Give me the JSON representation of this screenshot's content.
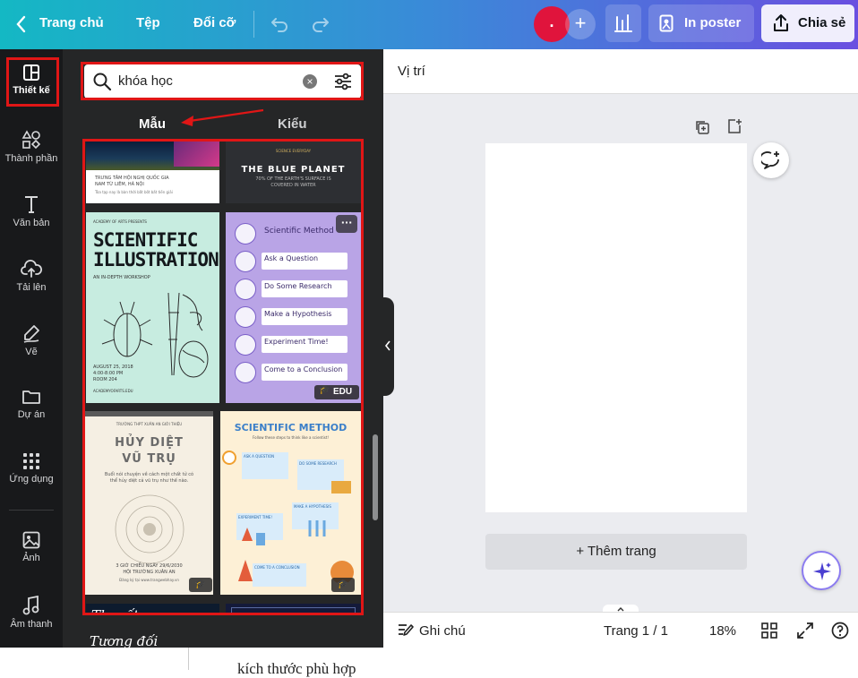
{
  "topbar": {
    "home_label": "Trang chủ",
    "file_label": "Tệp",
    "resize_label": "Đổi cỡ",
    "avatar_text": ".",
    "print_label": "In poster",
    "share_label": "Chia sẻ"
  },
  "rail": {
    "design": "Thiết kế",
    "elements": "Thành phần",
    "text": "Văn bản",
    "upload": "Tải lên",
    "draw": "Vẽ",
    "projects": "Dự án",
    "apps": "Ứng dụng",
    "photos": "Ảnh",
    "audio": "Âm thanh"
  },
  "search": {
    "value": "khóa học"
  },
  "tabs": {
    "templates": "Mẫu",
    "styles": "Kiểu"
  },
  "cards": {
    "c1_line1": "TRƯNG TÂM HỘI NGHỊ QUỐC GIA",
    "c1_line2": "NAM TỪ LIÊM, HÀ NỘI",
    "c1_line3": "Tòa tạp nay là bàn thời bắt bốt bất tiền giải",
    "c2_kicker": "SCIENCE EVERYDAY",
    "c2_title": "THE BLUE PLANET",
    "c2_sub": "70% OF THE EARTH'S SURFACE IS COVERED IN WATER",
    "c3_kicker": "ACADEMY OF ARTS PRESENTS",
    "c3_title": "SCIENTIFIC ILLUSTRATION",
    "c3_sub": "AN IN-DEPTH WORKSHOP",
    "c3_date": "AUGUST 25, 2018",
    "c3_time": "4:00-8:00 PM",
    "c3_room": "ROOM 204",
    "c3_url": "ACADEMYOFARTS.EDU",
    "c4_steps": [
      "Scientific Method",
      "Ask a Question",
      "Do Some Research",
      "Make a Hypothesis",
      "Experiment Time!",
      "Come to a Conclusion"
    ],
    "c4_more": "···",
    "c4_badge": "EDU",
    "c5_kicker": "TRƯỜNG THPT XUÂN AN GIỚI THIỆU",
    "c5_title1": "HỦY DIỆT",
    "c5_title2": "VŨ TRỤ",
    "c5_body": "Buổi nói chuyện về cách một chất tử có thể hủy diệt cả vũ trụ như thế nào.",
    "c5_when": "3 GIỜ CHIỀU NGÀY 29/6/2030",
    "c5_where": "HỘI TRƯỜNG XUÂN AN",
    "c5_reg": "Đăng ký tại www.trangwebhay.vn",
    "c6_title": "SCIENTIFIC METHOD",
    "c6_sub": "Follow these steps to think like a scientist!",
    "c6_s1": "ASK A QUESTION",
    "c6_s2": "DO SOME RESEARCH",
    "c6_s3": "MAKE A HYPOTHESIS",
    "c6_s4": "EXPERIMENT TIME!",
    "c6_s5": "COME TO A CONCLUSION",
    "c7_title1": "Thuyết",
    "c7_title2": "Tương đối"
  },
  "canvas": {
    "position_label": "Vị trí",
    "add_page": "+ Thêm trang"
  },
  "bottom": {
    "notes": "Ghi chú",
    "page_counter": "Trang 1 / 1",
    "zoom": "18%"
  },
  "doc_text": "kích thước phù hợp"
}
